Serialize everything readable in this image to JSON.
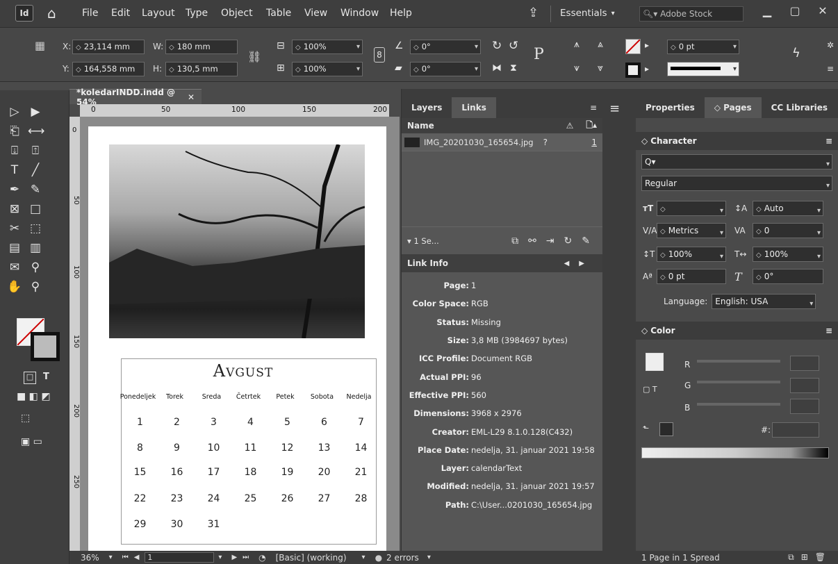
{
  "menubar": {
    "app_icon": "Id",
    "items": [
      "File",
      "Edit",
      "Layout",
      "Type",
      "Object",
      "Table",
      "View",
      "Window",
      "Help"
    ],
    "workspace": "Essentials",
    "stock_placeholder": "Adobe Stock"
  },
  "control": {
    "x_label": "X:",
    "x_value": "23,114 mm",
    "y_label": "Y:",
    "y_value": "164,558 mm",
    "w_label": "W:",
    "w_value": "180 mm",
    "h_label": "H:",
    "h_value": "130,5 mm",
    "scale_x": "100%",
    "scale_y": "100%",
    "rotate": "0°",
    "shear": "0°",
    "stroke_weight": "0 pt"
  },
  "document": {
    "tab_title": "*koledarINDD.indd @ 54%",
    "ruler_marks": [
      "0",
      "50",
      "100",
      "150",
      "200"
    ],
    "vruler_marks": [
      "0",
      "50",
      "100",
      "150",
      "200",
      "250"
    ]
  },
  "calendar": {
    "month": "Avgust",
    "days": [
      "Ponedeljek",
      "Torek",
      "Sreda",
      "Četrtek",
      "Petek",
      "Sobota",
      "Nedelja"
    ],
    "weeks": [
      [
        "1",
        "2",
        "3",
        "4",
        "5",
        "6",
        "7"
      ],
      [
        "8",
        "9",
        "10",
        "11",
        "12",
        "13",
        "14"
      ],
      [
        "15",
        "16",
        "17",
        "18",
        "19",
        "20",
        "21"
      ],
      [
        "22",
        "23",
        "24",
        "25",
        "26",
        "27",
        "28"
      ],
      [
        "29",
        "30",
        "31",
        "",
        "",
        "",
        ""
      ]
    ]
  },
  "links": {
    "tabs": [
      "Layers",
      "Links"
    ],
    "name_header": "Name",
    "file_name": "IMG_20201030_165654.jpg",
    "page_num": "1",
    "selected_count": "1 Se...",
    "info_title": "Link Info",
    "info": [
      {
        "label": "Page:",
        "value": "1"
      },
      {
        "label": "Color Space:",
        "value": "RGB"
      },
      {
        "label": "Status:",
        "value": "Missing"
      },
      {
        "label": "Size:",
        "value": "3,8 MB (3984697 bytes)"
      },
      {
        "label": "ICC Profile:",
        "value": "Document RGB"
      },
      {
        "label": "Actual PPI:",
        "value": "96"
      },
      {
        "label": "Effective PPI:",
        "value": "560"
      },
      {
        "label": "Dimensions:",
        "value": "3968 x 2976"
      },
      {
        "label": "Creator:",
        "value": "EML-L29 8.1.0.128(C432)"
      },
      {
        "label": "Place Date:",
        "value": "nedelja, 31. januar 2021 19:58"
      },
      {
        "label": "Layer:",
        "value": "calendarText"
      },
      {
        "label": "Modified:",
        "value": "nedelja, 31. januar 2021 19:57"
      },
      {
        "label": "Path:",
        "value": "C:\\User...0201030_165654.jpg"
      }
    ]
  },
  "right": {
    "tabs": [
      "Properties",
      "Pages",
      "CC Libraries"
    ],
    "character": {
      "title": "Character",
      "font_style": "Regular",
      "leading": "Auto",
      "kerning": "Metrics",
      "tracking": "0",
      "vscale": "100%",
      "hscale": "100%",
      "baseline": "0 pt",
      "skew": "0°",
      "language_label": "Language:",
      "language": "English: USA"
    },
    "color": {
      "title": "Color",
      "r": "R",
      "g": "G",
      "b": "B",
      "hash": "#:"
    },
    "status": "1 Page in 1 Spread"
  },
  "status": {
    "zoom": "36%",
    "page": "1",
    "profile": "[Basic] (working)",
    "errors": "2 errors"
  }
}
